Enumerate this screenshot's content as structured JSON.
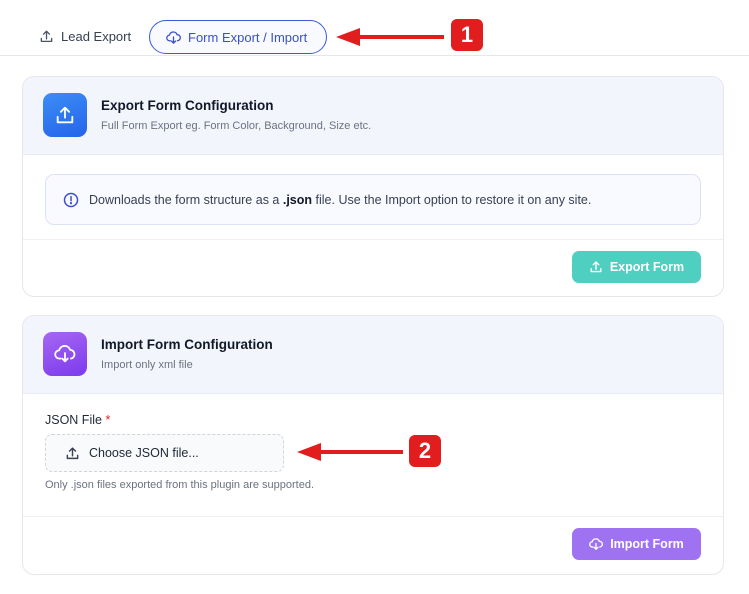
{
  "tabs": {
    "lead_export": "Lead Export",
    "form_export_import": "Form Export / Import"
  },
  "annotations": {
    "badge_1": "1",
    "badge_2": "2",
    "color": "#e11d1d"
  },
  "export_card": {
    "title": "Export Form Configuration",
    "subtitle": "Full Form Export eg. Form Color, Background, Size etc.",
    "notice_before": "Downloads the form structure as a",
    "notice_bold": ".json",
    "notice_after": "file. Use the Import option to restore it on any site.",
    "button_label": "Export Form",
    "icon": "upload-icon",
    "accent": "#2563eb",
    "button_color": "#4fcfc0"
  },
  "import_card": {
    "title": "Import Form Configuration",
    "subtitle": "Import only xml file",
    "field_label": "JSON File",
    "required_mark": "*",
    "file_button_label": "Choose JSON file...",
    "hint": "Only .json files exported from this plugin are supported.",
    "button_label": "Import Form",
    "icon": "cloud-download-icon",
    "accent": "#7c3aed",
    "button_color": "#9f72f2"
  }
}
